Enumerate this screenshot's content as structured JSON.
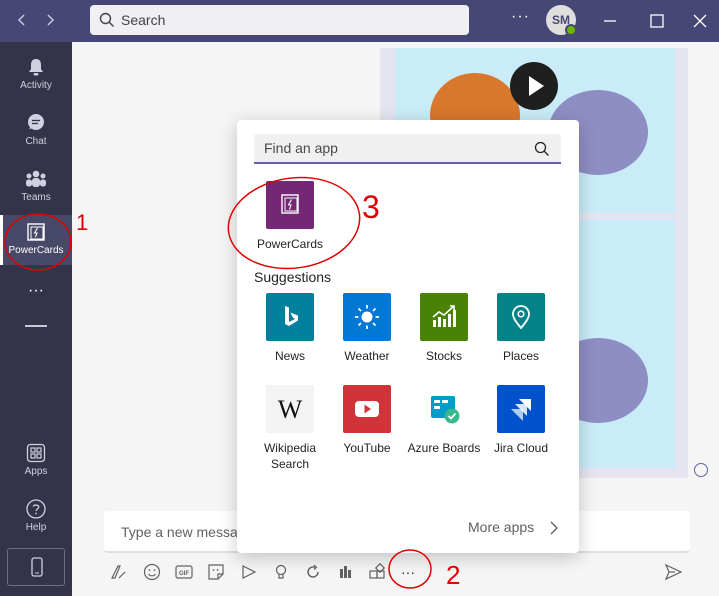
{
  "titlebar": {
    "search_placeholder": "Search",
    "more_label": "···",
    "user_initials": "SM",
    "presence_color": "#6bb700"
  },
  "rail": {
    "items": [
      {
        "label": "Activity",
        "icon": "bell-icon"
      },
      {
        "label": "Chat",
        "icon": "chat-icon"
      },
      {
        "label": "Teams",
        "icon": "teams-icon"
      },
      {
        "label": "PowerCards",
        "icon": "powercards-icon"
      },
      {
        "label": "···",
        "icon": "more-icon"
      },
      {
        "label": "Apps",
        "icon": "apps-icon"
      },
      {
        "label": "Help",
        "icon": "help-icon"
      }
    ]
  },
  "composer": {
    "placeholder": "Type a new message",
    "tools_more": "···"
  },
  "flyout": {
    "search_placeholder": "Find an app",
    "pinned_app": {
      "label": "PowerCards",
      "color": "#742774"
    },
    "suggestions_title": "Suggestions",
    "suggestions": [
      {
        "label": "News",
        "color": "#00809d",
        "icon": "bing-icon"
      },
      {
        "label": "Weather",
        "color": "#0078d4",
        "icon": "sun-icon"
      },
      {
        "label": "Stocks",
        "color": "#498205",
        "icon": "stocks-chart-icon"
      },
      {
        "label": "Places",
        "color": "#038387",
        "icon": "map-pin-icon"
      },
      {
        "label": "Wikipedia Search",
        "color": "#f3f3f3",
        "icon": "wikipedia-icon"
      },
      {
        "label": "YouTube",
        "color": "#d13438",
        "icon": "youtube-play-icon"
      },
      {
        "label": "Azure Boards",
        "color": "#ffffff",
        "icon": "azure-boards-icon"
      },
      {
        "label": "Jira Cloud",
        "color": "#0052cc",
        "icon": "jira-icon"
      }
    ],
    "more_apps_label": "More apps"
  },
  "annotations": {
    "step1": "1",
    "step2": "2",
    "step3": "3",
    "color": "#e00000"
  }
}
